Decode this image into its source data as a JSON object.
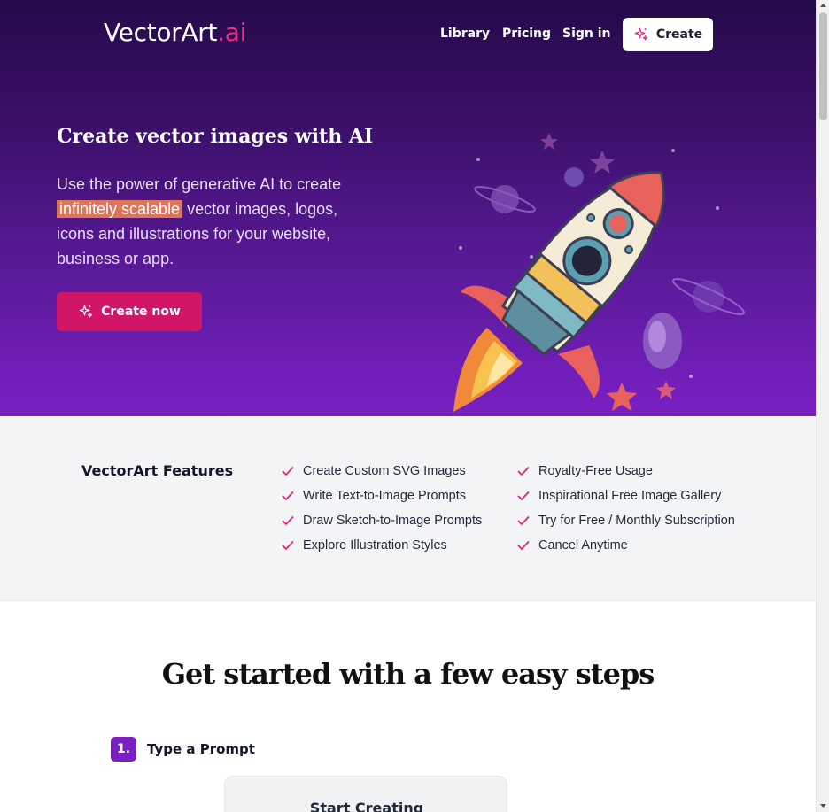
{
  "brand": {
    "name": "VectorArt",
    "suffix": ".ai"
  },
  "nav": {
    "library": "Library",
    "pricing": "Pricing",
    "signin": "Sign in",
    "create": "Create"
  },
  "hero": {
    "title": "Create vector images with AI",
    "desc_before": "Use the power of generative AI to create ",
    "desc_highlight": "infinitely scalable",
    "desc_after": " vector images, logos, icons and illustrations for your website, business or app.",
    "cta": "Create now"
  },
  "features": {
    "title": "VectorArt Features",
    "col1": [
      "Create Custom SVG Images",
      "Write Text-to-Image Prompts",
      "Draw Sketch-to-Image Prompts",
      "Explore Illustration Styles"
    ],
    "col2": [
      "Royalty-Free Usage",
      "Inspirational Free Image Gallery",
      "Try for Free / Monthly Subscription",
      "Cancel Anytime"
    ]
  },
  "steps": {
    "title": "Get started with a few easy steps",
    "step1_number": "1.",
    "step1_label": "Type a Prompt",
    "card_title": "Start Creating"
  },
  "colors": {
    "accent": "#ef2d84",
    "cta": "#d11667",
    "step_badge": "#7b1fc1",
    "hero_top": "#250a4a",
    "hero_bottom": "#7a20c4"
  },
  "icons": {
    "sparkle": "sparkle-icon",
    "check": "check-icon",
    "rocket": "rocket-illustration"
  }
}
